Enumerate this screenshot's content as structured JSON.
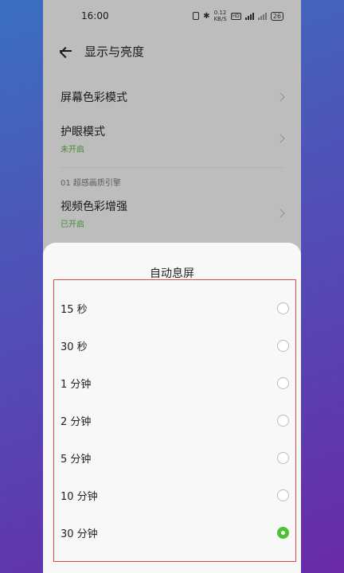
{
  "status": {
    "time": "16:00",
    "speed_value": "0.12",
    "speed_unit": "KB/S",
    "hd": "HD",
    "battery": "26"
  },
  "header": {
    "title": "显示与亮度"
  },
  "settings": {
    "items": [
      {
        "title": "屏幕色彩模式",
        "subtitle": ""
      },
      {
        "title": "护眼模式",
        "subtitle": "未开启"
      }
    ],
    "section_label": "01 超感画质引擎",
    "section_items": [
      {
        "title": "视频色彩增强",
        "subtitle": "已开启"
      }
    ]
  },
  "sheet": {
    "title": "自动息屏",
    "options": [
      {
        "label": "15 秒",
        "selected": false
      },
      {
        "label": "30 秒",
        "selected": false
      },
      {
        "label": "1 分钟",
        "selected": false
      },
      {
        "label": "2 分钟",
        "selected": false
      },
      {
        "label": "5 分钟",
        "selected": false
      },
      {
        "label": "10 分钟",
        "selected": false
      },
      {
        "label": "30 分钟",
        "selected": true
      }
    ]
  },
  "colors": {
    "accent_green": "#4fc036",
    "highlight_border": "#d94a4a"
  }
}
